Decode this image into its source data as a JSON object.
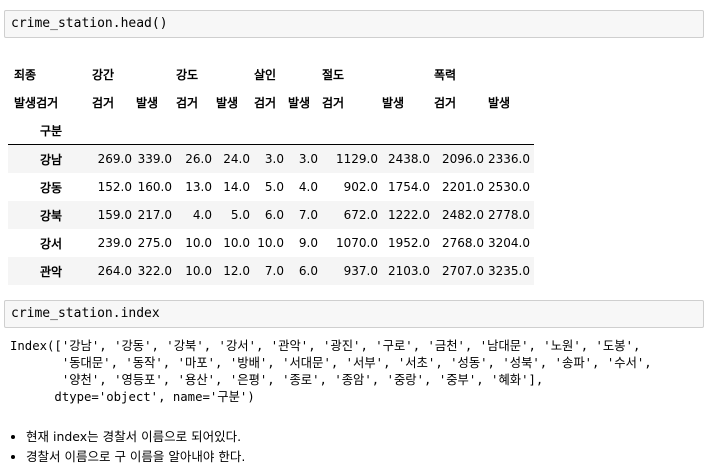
{
  "cell1": {
    "code": "crime_station.head()"
  },
  "table": {
    "header_row1": [
      "죄종",
      "강간",
      "",
      "강도",
      "",
      "살인",
      "",
      "절도",
      "",
      "폭력",
      ""
    ],
    "header_row2": [
      "발생검거",
      "검거",
      "발생",
      "검거",
      "발생",
      "검거",
      "발생",
      "검거",
      "발생",
      "검거",
      "발생"
    ],
    "index_name": "구분",
    "rows": [
      {
        "index": "강남",
        "values": [
          "269.0",
          "339.0",
          "26.0",
          "24.0",
          "3.0",
          "3.0",
          "1129.0",
          "2438.0",
          "2096.0",
          "2336.0"
        ]
      },
      {
        "index": "강동",
        "values": [
          "152.0",
          "160.0",
          "13.0",
          "14.0",
          "5.0",
          "4.0",
          "902.0",
          "1754.0",
          "2201.0",
          "2530.0"
        ]
      },
      {
        "index": "강북",
        "values": [
          "159.0",
          "217.0",
          "4.0",
          "5.0",
          "6.0",
          "7.0",
          "672.0",
          "1222.0",
          "2482.0",
          "2778.0"
        ]
      },
      {
        "index": "강서",
        "values": [
          "239.0",
          "275.0",
          "10.0",
          "10.0",
          "10.0",
          "9.0",
          "1070.0",
          "1952.0",
          "2768.0",
          "3204.0"
        ]
      },
      {
        "index": "관악",
        "values": [
          "264.0",
          "322.0",
          "10.0",
          "12.0",
          "7.0",
          "6.0",
          "937.0",
          "2103.0",
          "2707.0",
          "3235.0"
        ]
      }
    ]
  },
  "cell2": {
    "code": "crime_station.index"
  },
  "output": {
    "lines": [
      "Index(['강남', '강동', '강북', '강서', '관악', '광진', '구로', '금천', '남대문', '노원', '도봉',",
      "       '동대문', '동작', '마포', '방배', '서대문', '서부', '서초', '성동', '성북', '송파', '수서',",
      "       '양천', '영등포', '용산', '은평', '종로', '종암', '중랑', '중부', '혜화'],",
      "      dtype='object', name='구분')"
    ]
  },
  "notes": [
    "현재 index는 경찰서 이름으로 되어있다.",
    "경찰서 이름으로 구 이름을 알아내야 한다."
  ]
}
